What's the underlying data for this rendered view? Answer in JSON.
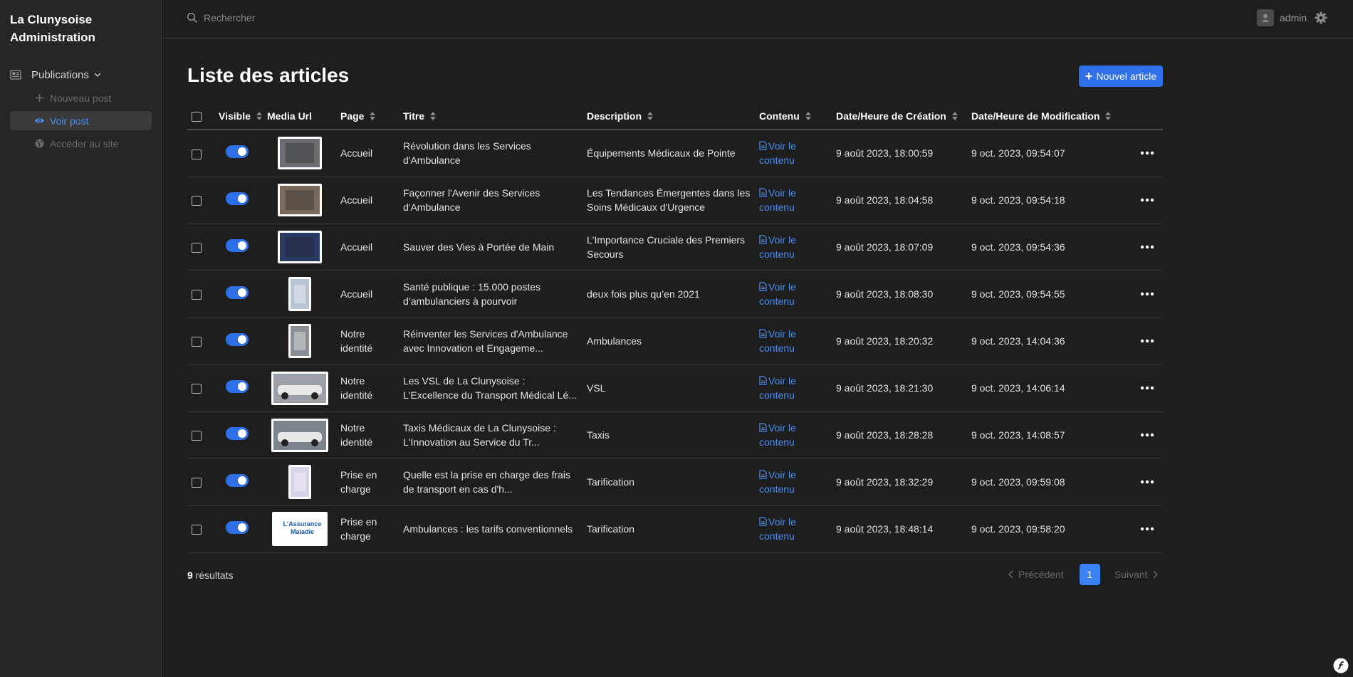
{
  "brand": {
    "line1": "La Clunysoise",
    "line2": "Administration"
  },
  "sidebar": {
    "section_label": "Publications",
    "items": [
      {
        "label": "Nouveau post",
        "icon": "plus-icon",
        "active": false
      },
      {
        "label": "Voir post",
        "icon": "eye-icon",
        "active": true
      },
      {
        "label": "Accéder au site",
        "icon": "globe-icon",
        "active": false
      }
    ]
  },
  "topbar": {
    "search_placeholder": "Rechercher",
    "user_name": "admin"
  },
  "page": {
    "title": "Liste des articles",
    "new_button_label": "Nouvel article"
  },
  "table": {
    "headers": {
      "visible": "Visible",
      "media": "Media Url",
      "page": "Page",
      "titre": "Titre",
      "description": "Description",
      "contenu": "Contenu",
      "created": "Date/Heure de Création",
      "modified": "Date/Heure de Modification"
    },
    "rows": [
      {
        "page": "Accueil",
        "titre": "Révolution dans les Services d'Ambulance",
        "description": "Équipements Médicaux de Pointe",
        "contenu": "Voir le contenu",
        "created": "9 août 2023, 18:00:59",
        "modified": "9 oct. 2023, 09:54:07"
      },
      {
        "page": "Accueil",
        "titre": "Façonner l'Avenir des Services d'Ambulance",
        "description": "Les Tendances Émergentes dans les Soins Médicaux d'Urgence",
        "contenu": "Voir le contenu",
        "created": "9 août 2023, 18:04:58",
        "modified": "9 oct. 2023, 09:54:18"
      },
      {
        "page": "Accueil",
        "titre": "Sauver des Vies à Portée de Main",
        "description": "L'Importance Cruciale des Premiers Secours",
        "contenu": "Voir le contenu",
        "created": "9 août 2023, 18:07:09",
        "modified": "9 oct. 2023, 09:54:36"
      },
      {
        "page": "Accueil",
        "titre": "Santé publique : 15.000 postes d’ambulanciers à pourvoir",
        "description": "deux fois plus qu’en 2021",
        "contenu": "Voir le contenu",
        "created": "9 août 2023, 18:08:30",
        "modified": "9 oct. 2023, 09:54:55"
      },
      {
        "page": "Notre identité",
        "titre": "Réinventer les Services d'Ambulance avec Innovation et Engageme...",
        "description": "Ambulances",
        "contenu": "Voir le contenu",
        "created": "9 août 2023, 18:20:32",
        "modified": "9 oct. 2023, 14:04:36"
      },
      {
        "page": "Notre identité",
        "titre": "Les VSL de La Clunysoise : L'Excellence du Transport Médical Lé...",
        "description": "VSL",
        "contenu": "Voir le contenu",
        "created": "9 août 2023, 18:21:30",
        "modified": "9 oct. 2023, 14:06:14"
      },
      {
        "page": "Notre identité",
        "titre": "Taxis Médicaux de La Clunysoise : L'Innovation au Service du Tr...",
        "description": "Taxis",
        "contenu": "Voir le contenu",
        "created": "9 août 2023, 18:28:28",
        "modified": "9 oct. 2023, 14:08:57"
      },
      {
        "page": "Prise en charge",
        "titre": "Quelle est la prise en charge des frais de transport en cas d'h...",
        "description": "Tarification",
        "contenu": "Voir le contenu",
        "created": "9 août 2023, 18:32:29",
        "modified": "9 oct. 2023, 09:59:08"
      },
      {
        "page": "Prise en charge",
        "titre": "Ambulances : les tarifs conventionnels",
        "description": "Tarification",
        "contenu": "Voir le contenu",
        "created": "9 août 2023, 18:48:14",
        "modified": "9 oct. 2023, 09:58:20"
      }
    ]
  },
  "thumbnails": [
    {
      "shape": "landscape",
      "tone": "#6a6e72",
      "label": ""
    },
    {
      "shape": "landscape",
      "tone": "#7a6a5e",
      "label": ""
    },
    {
      "shape": "landscape",
      "tone": "#2a3a66",
      "label": ""
    },
    {
      "shape": "portrait",
      "tone": "#b7c4d2",
      "label": ""
    },
    {
      "shape": "portrait",
      "tone": "#8a8f95",
      "label": ""
    },
    {
      "shape": "wide",
      "tone": "#9aa0a6",
      "label": ""
    },
    {
      "shape": "wide",
      "tone": "#7d838a",
      "label": ""
    },
    {
      "shape": "portrait",
      "tone": "#d9d2e9",
      "label": ""
    },
    {
      "shape": "logo",
      "tone": "#ffffff",
      "label": "L'Assurance Maladie"
    }
  ],
  "footer": {
    "count": "9",
    "results_label": "résultats"
  },
  "pagination": {
    "prev": "Précédent",
    "current": "1",
    "next": "Suivant"
  },
  "colors": {
    "accent": "#2f6fe8",
    "link": "#4a8ef0",
    "background": "#1e1e1e",
    "sidebar": "#262626"
  }
}
